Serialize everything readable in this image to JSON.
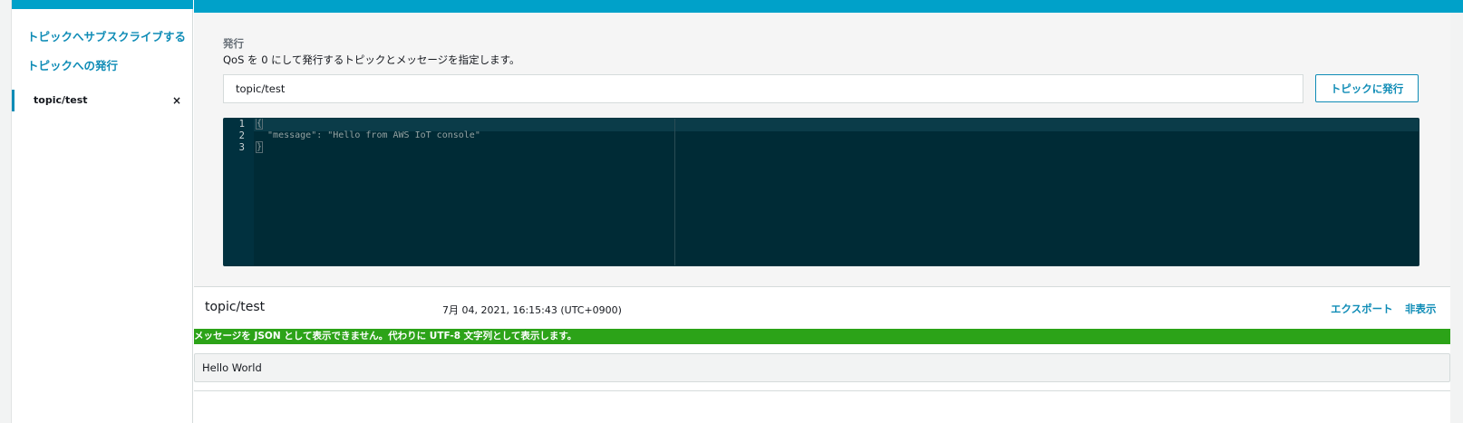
{
  "sidebar": {
    "links": [
      {
        "label": "トピックへサブスクライブする"
      },
      {
        "label": "トピックへの発行"
      }
    ],
    "subscriptions": [
      {
        "topic": "topic/test",
        "close_icon": "×"
      }
    ]
  },
  "publish": {
    "title": "発行",
    "description": "QoS を 0 にして発行するトピックとメッセージを指定します。",
    "topic_value": "topic/test",
    "button_label": "トピックに発行",
    "editor": {
      "line_numbers": [
        "1",
        "2",
        "3"
      ],
      "lines": [
        "{",
        "  \"message\": \"Hello from AWS IoT console\"",
        "}"
      ]
    }
  },
  "message": {
    "topic": "topic/test",
    "timestamp": "7月 04, 2021, 16:15:43 (UTC+0900)",
    "export_label": "エクスポート",
    "hide_label": "非表示",
    "warning": "メッセージを JSON として表示できません。代わりに UTF-8 文字列として表示します。",
    "payload": "Hello World"
  },
  "colors": {
    "accent": "#00a1c9",
    "link": "#0f8cb6",
    "success": "#2ca318",
    "editor_bg": "#002b36"
  }
}
